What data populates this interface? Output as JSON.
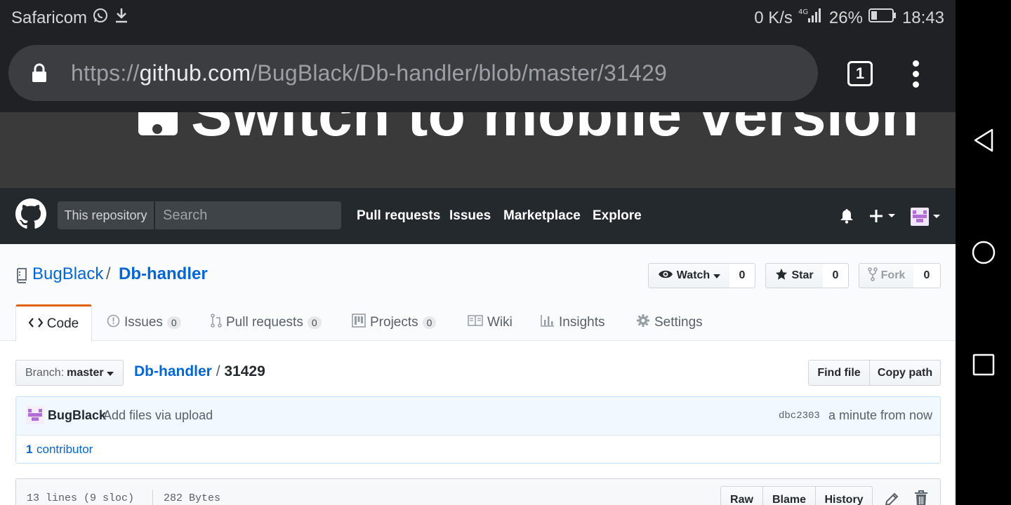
{
  "status_bar": {
    "carrier": "Safaricom",
    "speed": "0 K/s",
    "battery": "26%",
    "time": "18:43"
  },
  "browser": {
    "url_scheme": "https://",
    "url_host": "github.com",
    "url_path": "/BugBlack/Db-handler/blob/master/31429",
    "tab_count": "1"
  },
  "banner": {
    "text": "Switch to mobile version"
  },
  "header": {
    "scope_label": "This repository",
    "search_placeholder": "Search",
    "nav": [
      "Pull requests",
      "Issues",
      "Marketplace",
      "Explore"
    ]
  },
  "repo": {
    "owner": "BugBlack",
    "separator": "/",
    "name": "Db-handler",
    "watch_label": "Watch",
    "watch_count": "0",
    "star_label": "Star",
    "star_count": "0",
    "fork_label": "Fork",
    "fork_count": "0"
  },
  "tabs": [
    {
      "label": "Code"
    },
    {
      "label": "Issues",
      "count": "0"
    },
    {
      "label": "Pull requests",
      "count": "0"
    },
    {
      "label": "Projects",
      "count": "0"
    },
    {
      "label": "Wiki"
    },
    {
      "label": "Insights"
    },
    {
      "label": "Settings"
    }
  ],
  "file": {
    "branch_prefix": "Branch:",
    "branch": "master",
    "crumb_repo": "Db-handler",
    "crumb_sep": "/",
    "crumb_file": "31429",
    "find_file": "Find file",
    "copy_path": "Copy path"
  },
  "commit": {
    "author": "BugBlack",
    "message": "Add files via upload",
    "sha": "dbc2303",
    "time": "a minute from now",
    "contributors_count": "1",
    "contributors_label": "contributor"
  },
  "file_info": {
    "lines": "13 lines (9 sloc)",
    "size": "282 Bytes",
    "raw": "Raw",
    "blame": "Blame",
    "history": "History"
  },
  "colors": {
    "accent_tab": "#e36209",
    "link": "#0366d6",
    "header_bg": "#24292e"
  }
}
